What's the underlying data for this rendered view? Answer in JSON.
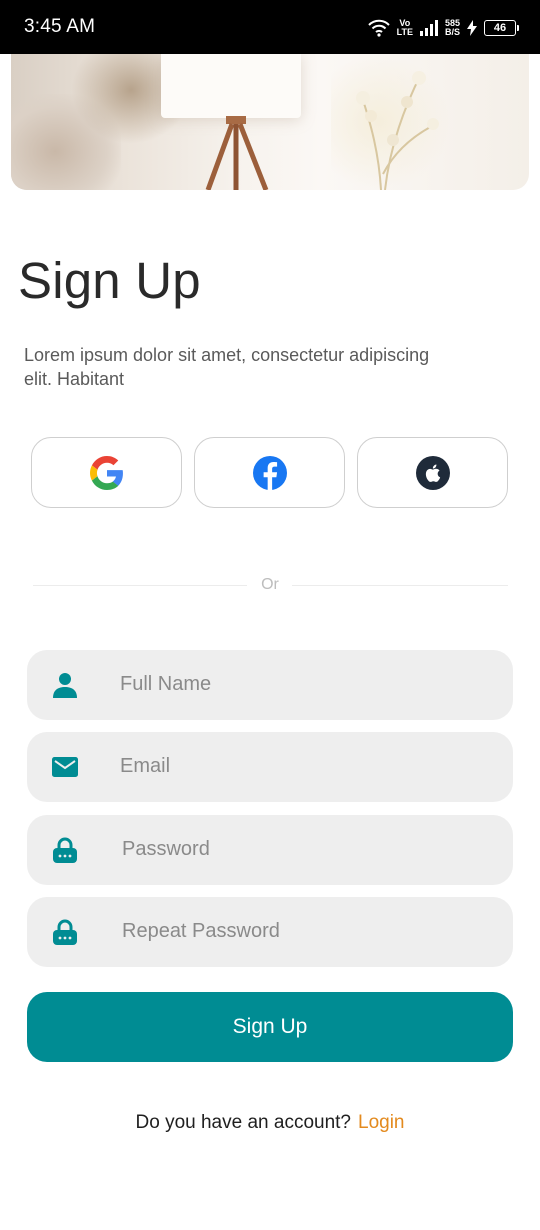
{
  "status_bar": {
    "time": "3:45 AM",
    "volte_top": "Vo",
    "volte_bottom": "LTE",
    "net_speed_value": "585",
    "net_speed_unit": "B/S",
    "battery": "46"
  },
  "header": {
    "title": "Sign Up",
    "subtitle": "Lorem ipsum dolor sit amet, consectetur adipiscing elit. Habitant"
  },
  "social": {
    "google_icon": "google-g-icon",
    "facebook_icon": "facebook-f-icon",
    "apple_icon": "apple-icon"
  },
  "divider": {
    "label": "Or"
  },
  "form": {
    "full_name_placeholder": "Full Name",
    "email_placeholder": "Email",
    "password_placeholder": "Password",
    "repeat_password_placeholder": "Repeat Password",
    "submit_label": "Sign Up"
  },
  "footer": {
    "prompt": "Do you have an account?",
    "login_label": "Login"
  },
  "colors": {
    "primary": "#008C93",
    "link": "#E38A1E",
    "field_bg": "#EEEEEE",
    "facebook": "#1877F2",
    "apple_circle": "#1F2B3A"
  }
}
